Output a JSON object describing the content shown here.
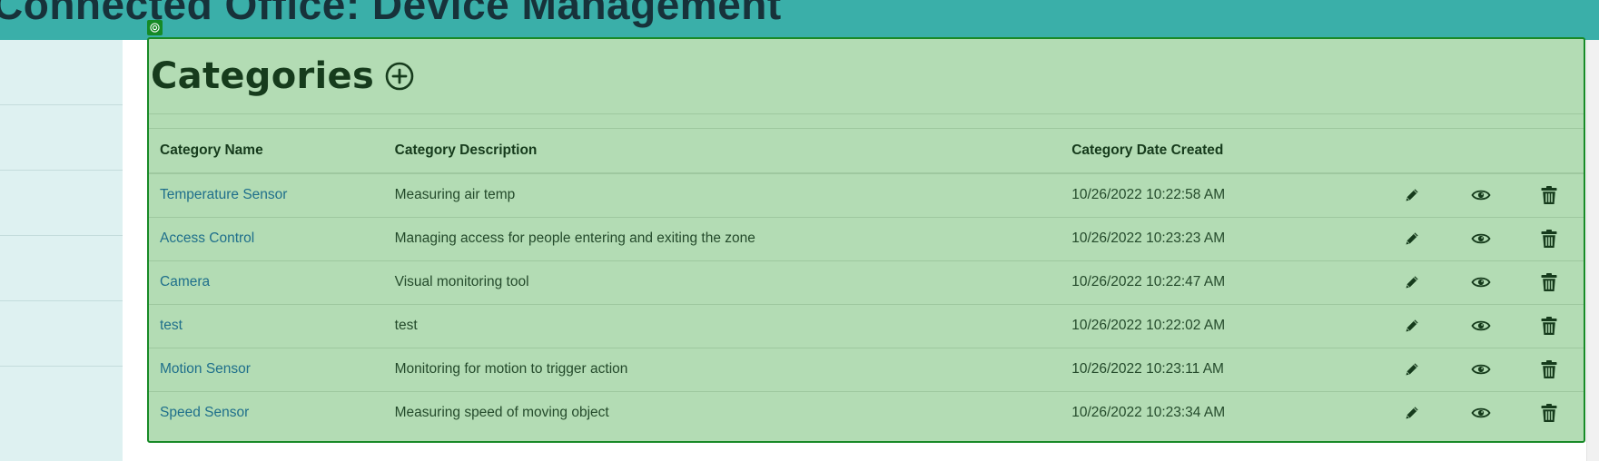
{
  "header": {
    "title": "Connected Office: Device Management",
    "background": "#3aafa9"
  },
  "panel": {
    "title": "Categories",
    "add_icon": "plus-circle-icon",
    "accent": "#188a27",
    "background": "#b3dcb4"
  },
  "table": {
    "headers": {
      "name": "Category Name",
      "description": "Category Description",
      "date": "Category Date Created"
    },
    "action_icons": [
      "pencil-icon",
      "eye-icon",
      "trash-icon"
    ],
    "rows": [
      {
        "name": "Temperature Sensor",
        "description": "Measuring air temp",
        "date": "10/26/2022 10:22:58 AM"
      },
      {
        "name": "Access Control",
        "description": "Managing access for people entering and exiting the zone",
        "date": "10/26/2022 10:23:23 AM"
      },
      {
        "name": "Camera",
        "description": "Visual monitoring tool",
        "date": "10/26/2022 10:22:47 AM"
      },
      {
        "name": "test",
        "description": "test",
        "date": "10/26/2022 10:22:02 AM"
      },
      {
        "name": "Motion Sensor",
        "description": "Monitoring for motion to trigger action",
        "date": "10/26/2022 10:23:11 AM"
      },
      {
        "name": "Speed Sensor",
        "description": "Measuring speed of moving object",
        "date": "10/26/2022 10:23:34 AM"
      }
    ]
  }
}
